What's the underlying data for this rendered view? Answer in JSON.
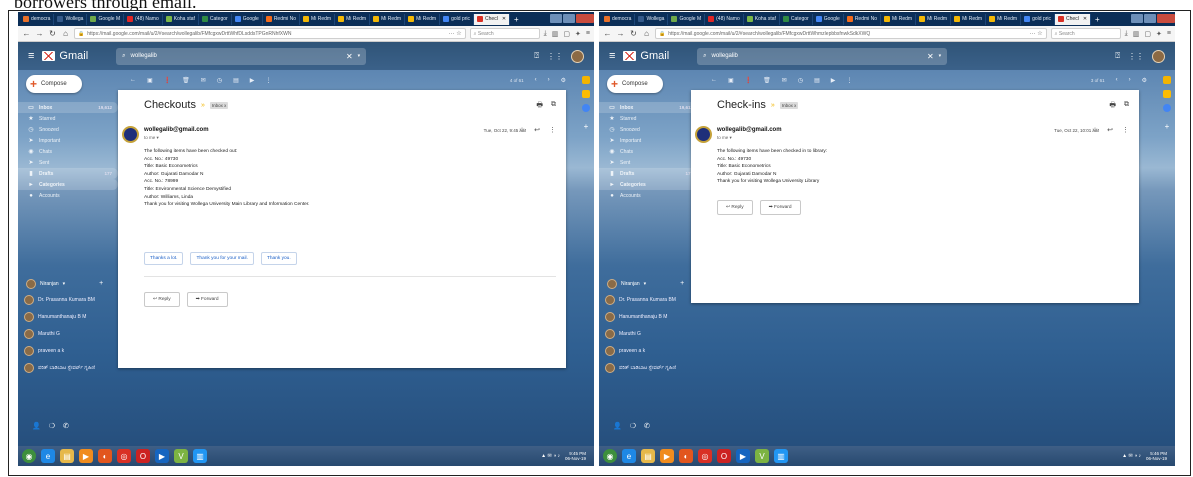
{
  "caption": "borrowers through email.",
  "screens": [
    {
      "tabs": [
        {
          "label": "democra",
          "color": "#e8702a"
        },
        {
          "label": "Wollega",
          "color": "#355a8a"
        },
        {
          "label": "Google M",
          "color": "#6ea84a"
        },
        {
          "label": "(48) Namo",
          "color": "#e02424"
        },
        {
          "label": "Koha staf",
          "color": "#7ab648"
        },
        {
          "label": "Categor",
          "color": "#2f8a44"
        },
        {
          "label": "Google",
          "color": "#4285f4"
        },
        {
          "label": "Redmi No",
          "color": "#f26a1b"
        },
        {
          "label": "Mi Redm",
          "color": "#f2b705"
        },
        {
          "label": "Mi Redm",
          "color": "#f2b705"
        },
        {
          "label": "Mi Redm",
          "color": "#f2b705"
        },
        {
          "label": "Mi Redm",
          "color": "#f2b705"
        },
        {
          "label": "gold pric",
          "color": "#4285f4"
        },
        {
          "label": "Checl",
          "color": "#d93025",
          "active": true
        }
      ],
      "url": "https://mail.google.com/mail/u/2/#search/wollegalib/FMfcgxwDrttWhfDLsddsTPGnRNhfXWN",
      "search_placeholder": "Search",
      "gmail_label": "Gmail",
      "search_query": "wollegalib",
      "compose": "Compose",
      "folders": [
        {
          "label": "Inbox",
          "count": "19,612",
          "icon": "▭",
          "active": true
        },
        {
          "label": "Starred",
          "count": "",
          "icon": "★"
        },
        {
          "label": "Snoozed",
          "count": "",
          "icon": "◷"
        },
        {
          "label": "Important",
          "count": "",
          "icon": "➤"
        },
        {
          "label": "Chats",
          "count": "",
          "icon": "◉"
        },
        {
          "label": "Sent",
          "count": "",
          "icon": "➤"
        },
        {
          "label": "Drafts",
          "count": "177",
          "icon": "▮",
          "active": true
        },
        {
          "label": "Categories",
          "count": "",
          "icon": "▸",
          "active": true
        },
        {
          "label": "Accounts",
          "count": "",
          "icon": "●"
        }
      ],
      "hangouts_user": "Niranjan",
      "contacts": [
        "Dr. Prasanna Kumara BM",
        "Hanumanthanaju B M",
        "Maruthi G",
        "praveen a k",
        "ಪರಿತ್ ಬಾಡಿಬಾಟ ಸ್ಟೇವರ್ಟ್ ಗೃಹಿಣಿ"
      ],
      "range": "4 of 61",
      "subject": "Checkouts",
      "label": "Inbox x",
      "sender": "wollegalib@gmail.com",
      "to": "to me ▾",
      "date": "Tue, Oct 22, 9:45 AM",
      "body": [
        "The following items have been checked out:",
        "Acc. No.: 49730",
        "Title: Basic Econometrics",
        "Author: Gujarati Damodar N",
        "Acc. No.: 78999",
        "Title: Environmental Science Demystified",
        "Author: Williams, Linda",
        "Thank you for visiting Wollega University Main Library and Information Center."
      ],
      "smart_replies": [
        "Thanks a lot.",
        "Thank you for your mail.",
        "Thank you."
      ],
      "reply": "Reply",
      "forward": "Forward",
      "clock_time": "9:45 PM",
      "clock_date": "06-Nov-19"
    },
    {
      "tabs": [
        {
          "label": "democra",
          "color": "#e8702a"
        },
        {
          "label": "Wollega",
          "color": "#355a8a"
        },
        {
          "label": "Google M",
          "color": "#6ea84a"
        },
        {
          "label": "(48) Namo",
          "color": "#e02424"
        },
        {
          "label": "Koha staf",
          "color": "#7ab648"
        },
        {
          "label": "Categor",
          "color": "#2f8a44"
        },
        {
          "label": "Google",
          "color": "#4285f4"
        },
        {
          "label": "Redmi No",
          "color": "#f26a1b"
        },
        {
          "label": "Mi Redm",
          "color": "#f2b705"
        },
        {
          "label": "Mi Redm",
          "color": "#f2b705"
        },
        {
          "label": "Mi Redm",
          "color": "#f2b705"
        },
        {
          "label": "Mi Redm",
          "color": "#f2b705"
        },
        {
          "label": "gold pric",
          "color": "#4285f4"
        },
        {
          "label": "Checl",
          "color": "#d93025",
          "active": true
        }
      ],
      "url": "https://mail.google.com/mail/u/2/#search/wollegalib/FMfcgxwDrttWhmzlepbbsfnwkSdkXWQ",
      "search_placeholder": "Search",
      "gmail_label": "Gmail",
      "search_query": "wollegalib",
      "compose": "Compose",
      "folders": [
        {
          "label": "Inbox",
          "count": "19,612",
          "icon": "▭",
          "active": true
        },
        {
          "label": "Starred",
          "count": "",
          "icon": "★"
        },
        {
          "label": "Snoozed",
          "count": "",
          "icon": "◷"
        },
        {
          "label": "Important",
          "count": "",
          "icon": "➤"
        },
        {
          "label": "Chats",
          "count": "",
          "icon": "◉"
        },
        {
          "label": "Sent",
          "count": "",
          "icon": "➤"
        },
        {
          "label": "Drafts",
          "count": "177",
          "icon": "▮",
          "active": true
        },
        {
          "label": "Categories",
          "count": "",
          "icon": "▸",
          "active": true
        },
        {
          "label": "Accounts",
          "count": "",
          "icon": "●"
        }
      ],
      "hangouts_user": "Niranjan",
      "contacts": [
        "Dr. Prasanna Kumara BM",
        "Hanumanthanaju B M",
        "Maruthi G",
        "praveen a k",
        "ಪರಿತ್ ಬಾಡಿಬಾಟ ಸ್ಟೇವರ್ಟ್ ಗೃಹಿಣಿ"
      ],
      "range": "3 of 61",
      "subject": "Check-ins",
      "label": "Inbox x",
      "sender": "wollegalib@gmail.com",
      "to": "to me ▾",
      "date": "Tue, Oct 22, 10:01 AM",
      "body": [
        "The following items have been checked in to library:",
        "Acc. No.: 49730",
        "Title: Basic Econometrics",
        "Author: Gujarati Damodar N",
        "Thank you for visiting Wollega University Library"
      ],
      "smart_replies": [],
      "reply": "Reply",
      "forward": "Forward",
      "clock_time": "5:46 PM",
      "clock_date": "06-Nov-19"
    }
  ],
  "taskbar_apps": [
    {
      "name": "start",
      "color": "#3d8f3d",
      "glyph": "◉"
    },
    {
      "name": "ie",
      "color": "#1e88e5",
      "glyph": "e"
    },
    {
      "name": "explorer",
      "color": "#e6b84a",
      "glyph": "▤"
    },
    {
      "name": "wmp",
      "color": "#f08c1e",
      "glyph": "▶"
    },
    {
      "name": "firefox",
      "color": "#e2561e",
      "glyph": "◐"
    },
    {
      "name": "chrome",
      "color": "#d93025",
      "glyph": "◎"
    },
    {
      "name": "opera",
      "color": "#c22",
      "glyph": "O"
    },
    {
      "name": "play",
      "color": "#1565c0",
      "glyph": "▶"
    },
    {
      "name": "vlc",
      "color": "#7cb342",
      "glyph": "V"
    },
    {
      "name": "app",
      "color": "#2196f3",
      "glyph": "▥"
    }
  ]
}
